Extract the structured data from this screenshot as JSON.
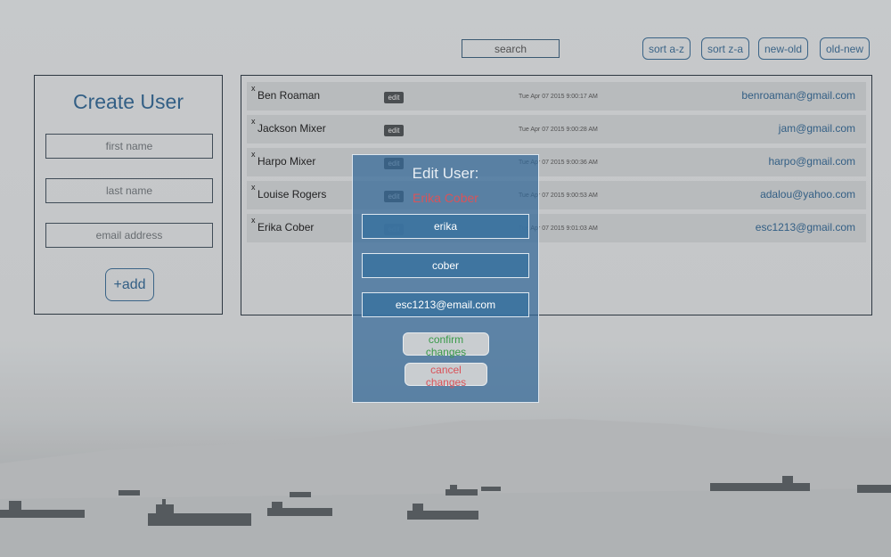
{
  "top_bar": {
    "search_placeholder": "search",
    "sort_buttons": [
      "sort a-z",
      "sort z-a",
      "new-old",
      "old-new"
    ]
  },
  "create_user": {
    "title": "Create User",
    "first_name_placeholder": "first name",
    "last_name_placeholder": "last name",
    "email_placeholder": "email address",
    "add_label": "+add"
  },
  "users": [
    {
      "remove": "x",
      "name": "Ben Roaman",
      "edit": "edit",
      "timestamp": "Tue Apr 07 2015 9:00:17 AM",
      "email": "benroaman@gmail.com"
    },
    {
      "remove": "x",
      "name": "Jackson Mixer",
      "edit": "edit",
      "timestamp": "Tue Apr 07 2015 9:00:28 AM",
      "email": "jam@gmail.com"
    },
    {
      "remove": "x",
      "name": "Harpo Mixer",
      "edit": "edit",
      "timestamp": "Tue Apr 07 2015 9:00:36 AM",
      "email": "harpo@gmail.com"
    },
    {
      "remove": "x",
      "name": "Louise Rogers",
      "edit": "edit",
      "timestamp": "Tue Apr 07 2015 9:00:53 AM",
      "email": "adalou@yahoo.com"
    },
    {
      "remove": "x",
      "name": "Erika Cober",
      "edit": "edit",
      "timestamp": "Tue Apr 07 2015 9:01:03 AM",
      "email": "esc1213@gmail.com"
    }
  ],
  "edit_modal": {
    "title": "Edit User:",
    "user_name": "Erika Cober",
    "first_name_value": "erika",
    "last_name_value": "cober",
    "email_value": "esc1213@email.com",
    "confirm_label": "confirm changes",
    "cancel_label": "cancel changes"
  },
  "colors": {
    "accent": "#35668f",
    "modal_bg": "#346a99",
    "confirm_text": "#3a9a4a",
    "cancel_text": "#d9535a"
  }
}
